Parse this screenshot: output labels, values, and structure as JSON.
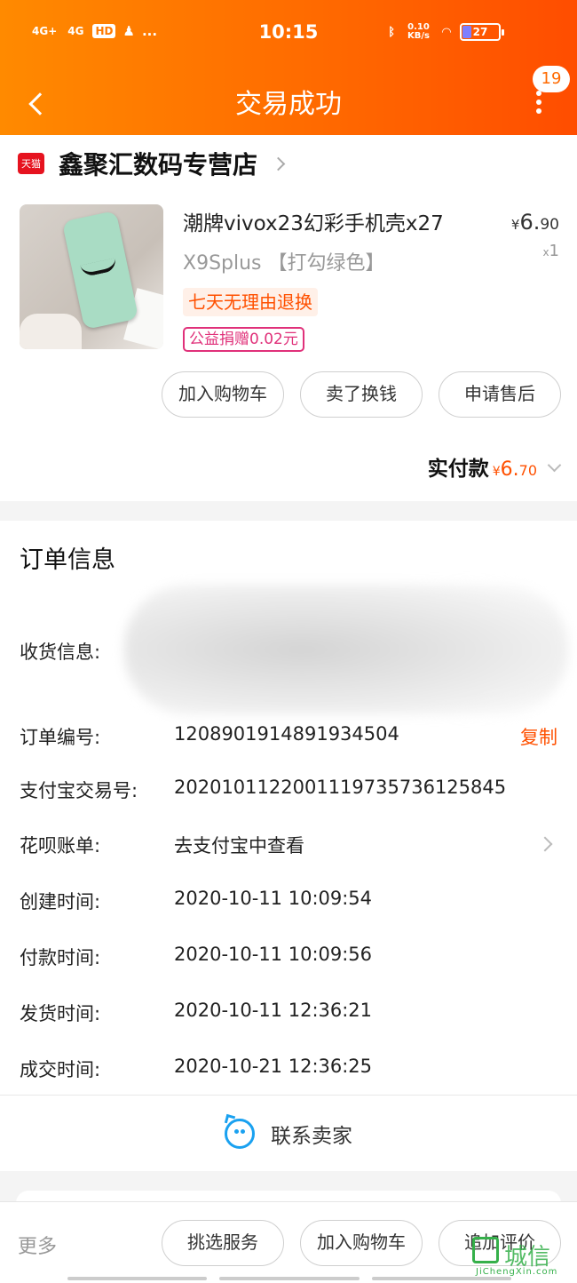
{
  "status_bar": {
    "network": [
      "4G+",
      "4G"
    ],
    "hd_label": "HD",
    "extra_icons": "...",
    "time": "10:15",
    "net_speed": "0.10\nKB/s",
    "battery": "27"
  },
  "nav": {
    "title": "交易成功",
    "message_count": "19"
  },
  "shop": {
    "badge": "天猫",
    "name": "鑫聚汇数码专营店"
  },
  "product": {
    "title": "潮牌vivox23幻彩手机壳x27",
    "sku": "X9Splus 【打勾绿色】",
    "price_symbol": "¥",
    "price_int": "6.",
    "price_dec": "90",
    "qty_prefix": "x",
    "qty": "1",
    "tag_return": "七天无理由退换",
    "tag_charity": "公益捐赠0.02元"
  },
  "actions": {
    "add_cart": "加入购物车",
    "sell": "卖了换钱",
    "after_sale": "申请售后"
  },
  "payment": {
    "label": "实付款",
    "symbol": "¥",
    "amount_int": "6.",
    "amount_dec": "70"
  },
  "order_info": {
    "heading": "订单信息",
    "address_label": "收货信息:",
    "rows": [
      {
        "label": "订单编号:",
        "value": "1208901914891934504",
        "action": "复制"
      },
      {
        "label": "支付宝交易号:",
        "value": "2020101122001119735736125845"
      },
      {
        "label": "花呗账单:",
        "value": "去支付宝中查看"
      },
      {
        "label": "创建时间:",
        "value": "2020-10-11 10:09:54"
      },
      {
        "label": "付款时间:",
        "value": "2020-10-11 10:09:56"
      },
      {
        "label": "发货时间:",
        "value": "2020-10-11 12:36:21"
      },
      {
        "label": "成交时间:",
        "value": "2020-10-21 12:36:25"
      }
    ],
    "contact": "联系卖家"
  },
  "bottom_bar": {
    "more": "更多",
    "service": "挑选服务",
    "add_cart": "加入购物车",
    "review": "追加评价"
  },
  "watermark": {
    "text": "城信",
    "url": "JiChengXin.com"
  },
  "colors": {
    "header_start": "#ff8a00",
    "header_end": "#ff4d00",
    "accent": "#ff5000",
    "charity": "#e0317a",
    "contact": "#1aa1f0"
  }
}
